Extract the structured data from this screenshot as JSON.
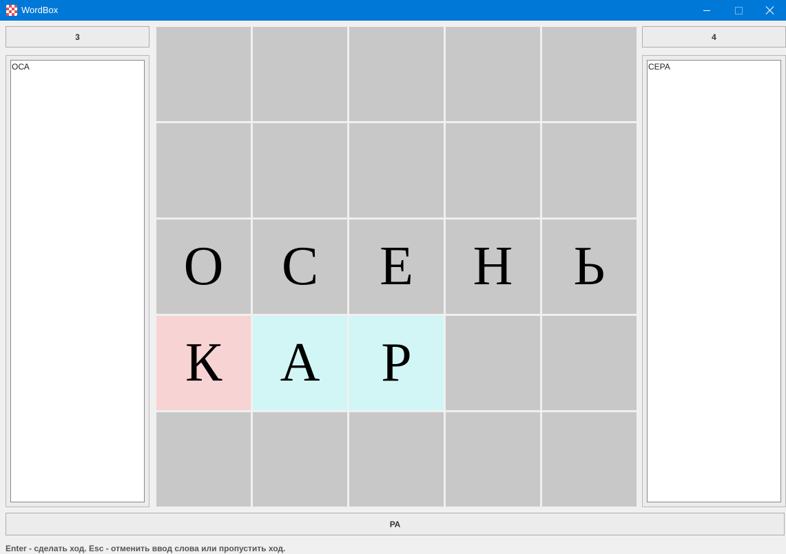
{
  "window": {
    "title": "WordBox"
  },
  "scores": {
    "left": "3",
    "right": "4"
  },
  "player_left": {
    "words": [
      "ОСА"
    ]
  },
  "player_right": {
    "words": [
      "СЕРА"
    ]
  },
  "board": {
    "rows": [
      [
        "",
        "",
        "",
        "",
        ""
      ],
      [
        "",
        "",
        "",
        "",
        ""
      ],
      [
        "О",
        "С",
        "Е",
        "Н",
        "Ь"
      ],
      [
        "К",
        "А",
        "Р",
        "",
        ""
      ],
      [
        "",
        "",
        "",
        "",
        ""
      ]
    ],
    "highlight": [
      [
        null,
        null,
        null,
        null,
        null
      ],
      [
        null,
        null,
        null,
        null,
        null
      ],
      [
        null,
        null,
        null,
        null,
        null
      ],
      [
        "new-letter",
        "selected",
        "selected",
        null,
        null
      ],
      [
        null,
        null,
        null,
        null,
        null
      ]
    ]
  },
  "current_word": "РА",
  "status_text": "Enter - сделать ход. Esc - отменить ввод слова или пропустить ход.",
  "colors": {
    "titlebar": "#0078d7",
    "cell_empty": "#c8c8c8",
    "cell_new": "#f8d3d3",
    "cell_selected": "#d2f6f6"
  }
}
